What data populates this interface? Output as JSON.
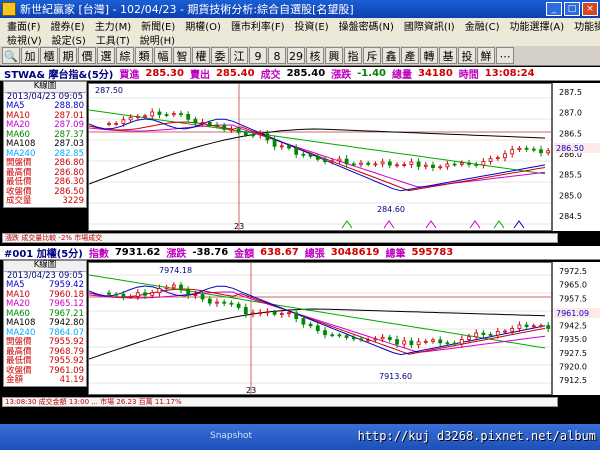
{
  "app": {
    "title": "新世紀贏家 [台灣] - 102/04/23 - 期貨技術分析:綜合自選股[名望股]",
    "controls": {
      "minimize": "_",
      "maximize": "□",
      "close": "×"
    }
  },
  "menus": {
    "row1": [
      "畫面(F)",
      "證券(E)",
      "主力(M)",
      "新聞(E)",
      "期權(O)",
      "匯市利率(F)",
      "投資(E)",
      "操盤密碼(N)",
      "國際資訊(I)",
      "金融(C)",
      "功能選擇(A)",
      "功能操作(F)"
    ],
    "row2": [
      "檢視(V)",
      "設定(S)",
      "工具(T)",
      "說明(H)"
    ]
  },
  "toolbar": [
    "🔍",
    "加",
    "櫃",
    "期",
    "價",
    "選",
    "綜",
    "類",
    "幅",
    "智",
    "權",
    "委",
    "江",
    "9",
    "8",
    "29",
    "核",
    "興",
    "指",
    "斥",
    "鑫",
    "產",
    "轉",
    "基",
    "投",
    "鮮",
    "⋯"
  ],
  "panel1": {
    "header": {
      "symbol": "STWA& 摩台指&(5分)",
      "bid_label": "買進",
      "bid": "285.30",
      "ask_label": "賣出",
      "ask": "285.40",
      "last_label": "成交",
      "last": "285.40",
      "chg_label": "漲跌",
      "chg": "-1.40",
      "vol_label": "總量",
      "vol": "34180",
      "time_label": "時間",
      "time": "13:08:24"
    },
    "info": {
      "kline": "K線圖",
      "date": "2013/04/23 09:05",
      "rows": [
        {
          "label": "MA5",
          "value": "288.80",
          "color": "#0000cc"
        },
        {
          "label": "MA10",
          "value": "287.01",
          "color": "#cc0000"
        },
        {
          "label": "MA20",
          "value": "287.09",
          "color": "#cc00cc"
        },
        {
          "label": "MA60",
          "value": "287.37",
          "color": "#008800"
        },
        {
          "label": "MA108",
          "value": "287.03",
          "color": "#000000"
        },
        {
          "label": "MA240",
          "value": "282.85",
          "color": "#00aaff"
        },
        {
          "label": "開盤價",
          "value": "286.80",
          "color": "#cc0000"
        },
        {
          "label": "最高價",
          "value": "286.80",
          "color": "#cc0000"
        },
        {
          "label": "最低價",
          "value": "286.30",
          "color": "#cc0000"
        },
        {
          "label": "收盤價",
          "value": "286.50",
          "color": "#cc0000"
        },
        {
          "label": "成交量",
          "value": "3229",
          "color": "#cc0000"
        }
      ]
    },
    "annot_high": "287.50",
    "annot_low": "284.60",
    "date_mark": "23",
    "price_marker": "286.50",
    "axis": [
      "287.5",
      "287.0",
      "286.5",
      "286.0",
      "285.5",
      "285.0",
      "284.5"
    ],
    "status": "漲跌  成交量比較  -2% 市場成交"
  },
  "panel2": {
    "header": {
      "symbol": "#001 加權(5分)",
      "idx_label": "指數",
      "idx": "7931.62",
      "chg_label": "漲跌",
      "chg": "-38.76",
      "amt_label": "金額",
      "amt": "638.67",
      "vol_label": "總張",
      "vol": "3048619",
      "cnt_label": "總筆",
      "cnt": "595783"
    },
    "info": {
      "kline": "K線圖",
      "date": "2013/04/23 09:05",
      "rows": [
        {
          "label": "MA5",
          "value": "7959.42",
          "color": "#0000cc"
        },
        {
          "label": "MA10",
          "value": "7960.18",
          "color": "#cc0000"
        },
        {
          "label": "MA20",
          "value": "7965.12",
          "color": "#cc00cc"
        },
        {
          "label": "MA60",
          "value": "7967.21",
          "color": "#008800"
        },
        {
          "label": "MA108",
          "value": "7942.80",
          "color": "#000000"
        },
        {
          "label": "MA240",
          "value": "7864.07",
          "color": "#00aaff"
        },
        {
          "label": "開盤價",
          "value": "7955.92",
          "color": "#cc0000"
        },
        {
          "label": "最高價",
          "value": "7968.79",
          "color": "#cc0000"
        },
        {
          "label": "最低價",
          "value": "7955.92",
          "color": "#cc0000"
        },
        {
          "label": "收盤價",
          "value": "7961.09",
          "color": "#cc0000"
        },
        {
          "label": "金額",
          "value": "41.19",
          "color": "#cc0000"
        }
      ]
    },
    "annot_high": "7974.18",
    "annot_low": "7913.60",
    "date_mark": "23",
    "price_marker": "7961.09",
    "axis": [
      "7972.5",
      "7965.0",
      "7957.5",
      "7950.0",
      "7942.5",
      "7935.0",
      "7927.5",
      "7920.0",
      "7912.5"
    ],
    "status": "13:08:30  成交金額 13:00 ...  市場 26.23 百萬 11.17%"
  },
  "taskbar": {
    "url": "http://kuj d3268.pixnet.net/album",
    "label": "Snapshot"
  },
  "colors": {
    "up": "#cc0000",
    "down": "#008800",
    "ma5": "#0000cc",
    "ma10": "#cc0000",
    "ma20": "#cc00cc",
    "ma60": "#00aa00",
    "ma108": "#000000"
  }
}
